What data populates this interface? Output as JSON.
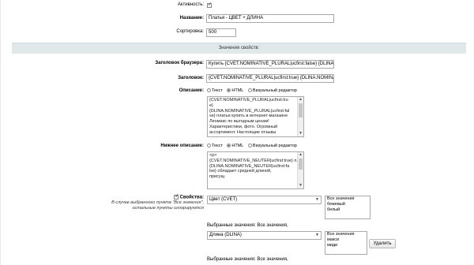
{
  "fields": {
    "active_label": "Активность:",
    "name_label": "Название:",
    "name_value": "Платья - ЦВЕТ + ДЛИНА",
    "sort_label": "Сортировка:",
    "sort_value": "500"
  },
  "section_title": "Значения свойств:",
  "browser_title_label": "Заголовок браузера:",
  "browser_title_value": "Купить {CVET.NOMINATIVE_PLURAL|ucfirst:false} {DLINA.N",
  "heading_label": "Заголовок:",
  "heading_value": "{CVET.NOMINATIVE_PLURAL|ucfirst:true} {DLINA.NOMINAT",
  "description": {
    "label": "Описание:",
    "modes": [
      "Текст",
      "HTML",
      "Визуальный редактор"
    ],
    "lines": [
      "{CVET.NOMINATIVE_PLURAL|ucfirst:tru",
      "e}",
      "{DLINA.NOMINATIVE_PLURAL|ucfirst:fal",
      "se} платья купить в интернет-магазине",
      "Леомакс по выгодным ценам!",
      "Характеристики, фото. Огромный",
      "ассортимент. Настоящие отзывы"
    ]
  },
  "lower_description": {
    "label": "Нижнее описание:",
    "modes": [
      "Текст",
      "HTML",
      "Визуальный редактор"
    ],
    "lines": [
      "<p>",
      "{CVET.NOMINATIVE_NEUTER|ucfirst:true} платье",
      "{DLINA.NOMINATIVE_NEUTER|ucfirst:fa",
      "lse} обладает средней длиной,",
      "присущ"
    ]
  },
  "properties": {
    "label": "Свойства:",
    "note": "В случае выбранного пункта \"Все значения\", остальные пункты игнорируются",
    "color_select": "Цвет (CVET)",
    "color_options": [
      "Все значения",
      "бежевый",
      "белый"
    ],
    "selected_color": "Выбранные значения: Все значения,",
    "length_select": "Длина (DLINA)",
    "length_options": [
      "Все значения",
      "макси",
      "миди"
    ],
    "delete_button": "Удалить",
    "selected_length": "Выбранные значения: Все значения,"
  }
}
